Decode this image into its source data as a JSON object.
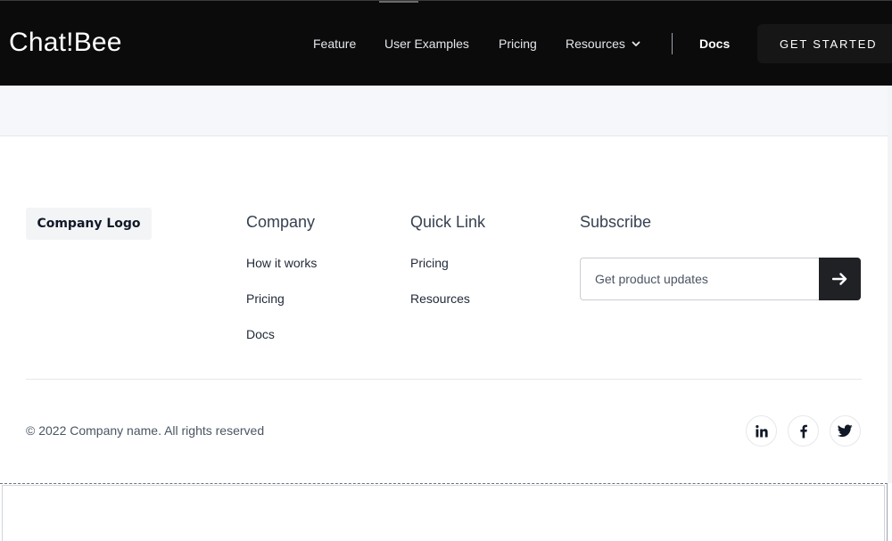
{
  "header": {
    "brand": "Chat!Bee",
    "nav": {
      "feature": "Feature",
      "user_examples": "User Examples",
      "pricing": "Pricing",
      "resources": "Resources",
      "docs": "Docs"
    },
    "cta": "GET STARTED"
  },
  "footer": {
    "logo": "Company Logo",
    "company": {
      "heading": "Company",
      "links": [
        "How it works",
        "Pricing",
        "Docs"
      ]
    },
    "quick_link": {
      "heading": "Quick Link",
      "links": [
        "Pricing",
        "Resources"
      ]
    },
    "subscribe": {
      "heading": "Subscribe",
      "placeholder": "Get product updates"
    },
    "copyright": "© 2022 Company name. All rights reserved",
    "social": [
      "linkedin-icon",
      "facebook-icon",
      "twitter-icon"
    ]
  },
  "colors": {
    "header_bg": "#0b0b0b",
    "band_bg": "#f6f7fa",
    "button_dark": "#1f2125"
  }
}
